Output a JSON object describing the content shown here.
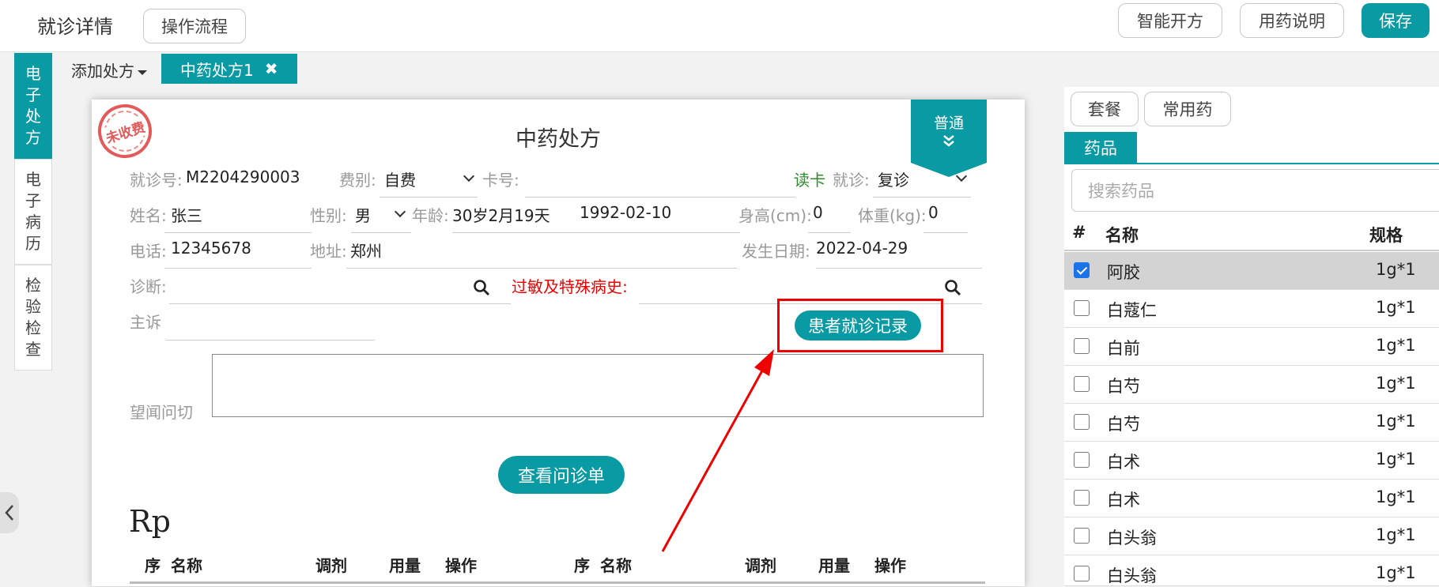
{
  "header": {
    "title": "就诊详情",
    "flow_button": "操作流程",
    "smart_rx_button": "智能开方",
    "drug_info_button": "用药说明",
    "save_button": "保存"
  },
  "side_tabs": [
    {
      "label": "电子处方",
      "chars": [
        "电",
        "子",
        "处",
        "方"
      ]
    },
    {
      "label": "电子病历",
      "chars": [
        "电",
        "子",
        "病",
        "历"
      ]
    },
    {
      "label": "检验检查",
      "chars": [
        "检",
        "验",
        "检",
        "查"
      ]
    }
  ],
  "rx_tabs": {
    "add_label": "添加处方",
    "active_tab": "中药处方1",
    "close_glyph": "✖"
  },
  "prescription": {
    "stamp": "未收费",
    "title": "中药处方",
    "type_badge": "普通",
    "visit_no_label": "就诊号:",
    "visit_no": "M2204290003",
    "fee_label": "费别:",
    "fee_value": "自费",
    "card_label": "卡号:",
    "card_value": "",
    "read_card": "读卡",
    "visit_type_label": "就诊:",
    "visit_type_value": "复诊",
    "name_label": "姓名:",
    "name_value": "张三",
    "gender_label": "性别:",
    "gender_value": "男",
    "age_label": "年龄:",
    "age_value": "30岁2月19天",
    "birth_date": "1992-02-10",
    "height_label": "身高(cm):",
    "height_value": "0",
    "weight_label": "体重(kg):",
    "weight_value": "0",
    "phone_label": "电话:",
    "phone_value": "12345678",
    "address_label": "地址:",
    "address_value": "郑州",
    "onset_label": "发生日期:",
    "onset_value": "2022-04-29",
    "diagnosis_label": "诊断:",
    "allergy_label": "过敏及特殊病史:",
    "complaint_label": "主诉",
    "visit_records_button": "患者就诊记录",
    "tcm_exam_label": "望闻问切",
    "view_inquiry_button": "查看问诊单",
    "rp_label": "Rp",
    "table_headers": [
      "序",
      "名称",
      "调剂",
      "用量",
      "操作",
      "序",
      "名称",
      "调剂",
      "用量",
      "操作"
    ]
  },
  "right_panel": {
    "package_button": "套餐",
    "common_drug_button": "常用药",
    "drug_tab": "药品",
    "search_placeholder": "搜索药品",
    "col_index": "#",
    "col_name": "名称",
    "col_spec": "规格",
    "drugs": [
      {
        "name": "阿胶",
        "spec": "1g*1",
        "checked": true
      },
      {
        "name": "白蔻仁",
        "spec": "1g*1",
        "checked": false
      },
      {
        "name": "白前",
        "spec": "1g*1",
        "checked": false
      },
      {
        "name": "白芍",
        "spec": "1g*1",
        "checked": false
      },
      {
        "name": "白芍",
        "spec": "1g*1",
        "checked": false
      },
      {
        "name": "白术",
        "spec": "1g*1",
        "checked": false
      },
      {
        "name": "白术",
        "spec": "1g*1",
        "checked": false
      },
      {
        "name": "白头翁",
        "spec": "1g*1",
        "checked": false
      },
      {
        "name": "白头翁",
        "spec": "1g*1",
        "checked": false
      }
    ]
  },
  "colors": {
    "accent": "#0a9aa3",
    "highlight": "#e00000",
    "read_card": "#2e8b2e"
  }
}
